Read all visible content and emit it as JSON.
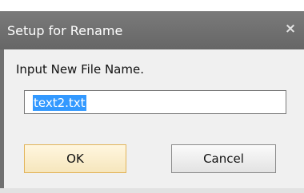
{
  "dialog": {
    "title": "Setup for Rename",
    "close_icon": "close-icon",
    "prompt": "Input New File Name.",
    "input_value": "text2.txt",
    "ok_label": "OK",
    "cancel_label": "Cancel"
  }
}
